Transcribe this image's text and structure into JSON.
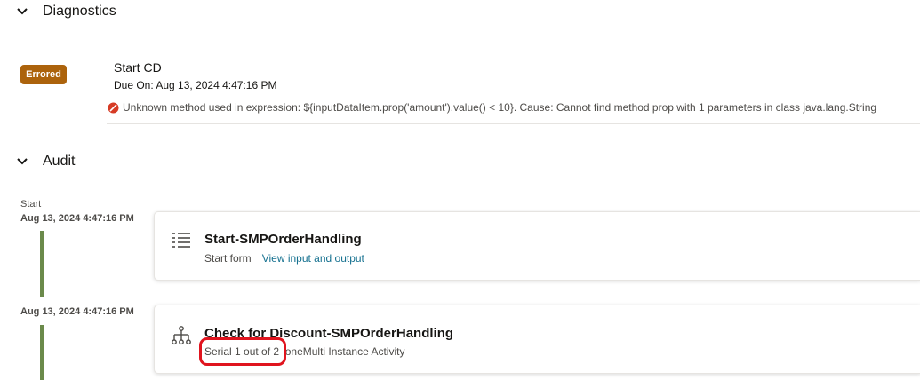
{
  "diagnostics": {
    "title": "Diagnostics",
    "error": {
      "badge": "Errored",
      "title": "Start CD",
      "due": "Due On: Aug 13, 2024 4:47:16 PM",
      "message": "Unknown method used in expression: ${inputDataItem.prop('amount').value() < 10}. Cause: Cannot find method prop with 1 parameters in class java.lang.String"
    }
  },
  "audit": {
    "title": "Audit",
    "entries": [
      {
        "label": "Start",
        "timestamp": "Aug 13, 2024 4:47:16 PM",
        "icon": "list-icon",
        "title": "Start-SMPOrderHandling",
        "subtitle": "Start form",
        "link": "View input and output"
      },
      {
        "timestamp": "Aug 13, 2024 4:47:16 PM",
        "icon": "hierarchy-icon",
        "title": "Check for Discount-SMPOrderHandling",
        "subtitle": "Serial 1 out of 2  oneMulti Instance Activity"
      }
    ]
  },
  "colors": {
    "badge": "#ac630c",
    "timeline": "#6b8a4b",
    "link": "#14708f",
    "error": "#d63b25",
    "annotation": "#e0141e"
  }
}
